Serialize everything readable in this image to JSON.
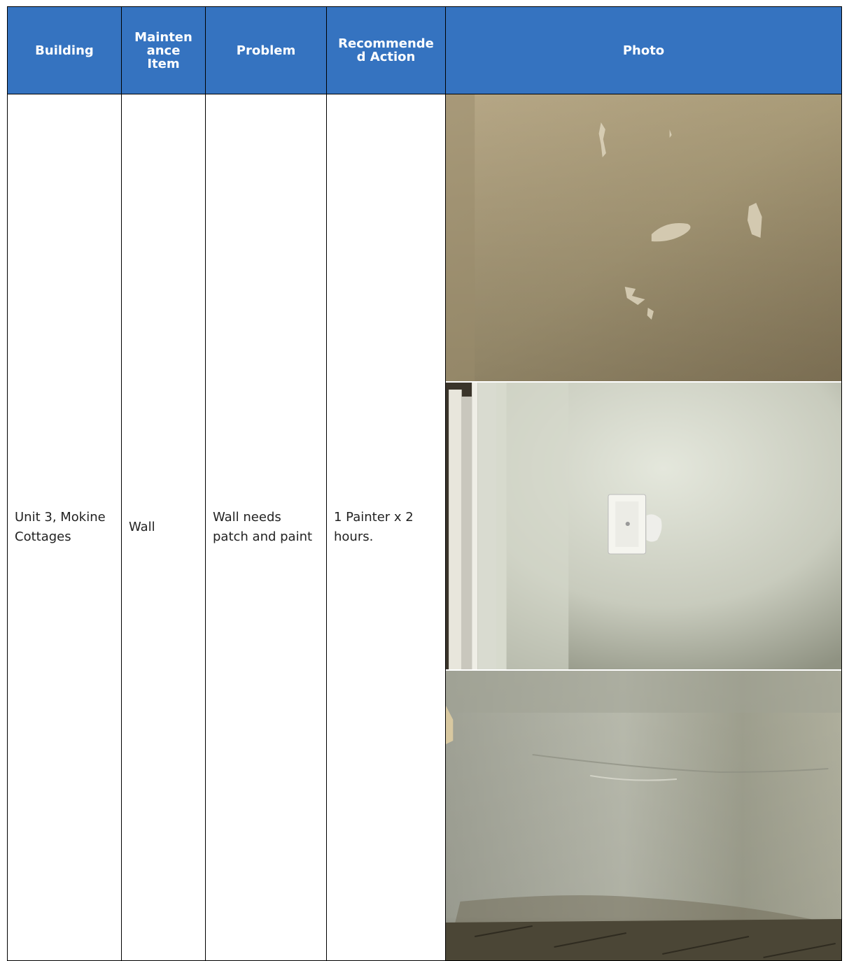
{
  "table": {
    "headers": [
      "Building",
      "Mainten\nance\nItem",
      "Problem",
      "Recommende\nd Action",
      "Photo"
    ],
    "rows": [
      {
        "building": "Unit 3, Mokine Cottages",
        "maintenance_item": "Wall",
        "problem": "Wall needs patch and paint",
        "recommended_action": "1 Painter x 2 hours.",
        "photos": [
          "wall-damage-photo-1",
          "wall-outlet-photo-2",
          "wall-scuff-photo-3"
        ]
      }
    ]
  },
  "colors": {
    "header_bg": "#3573c0",
    "header_text": "#ffffff",
    "border": "#000000"
  }
}
